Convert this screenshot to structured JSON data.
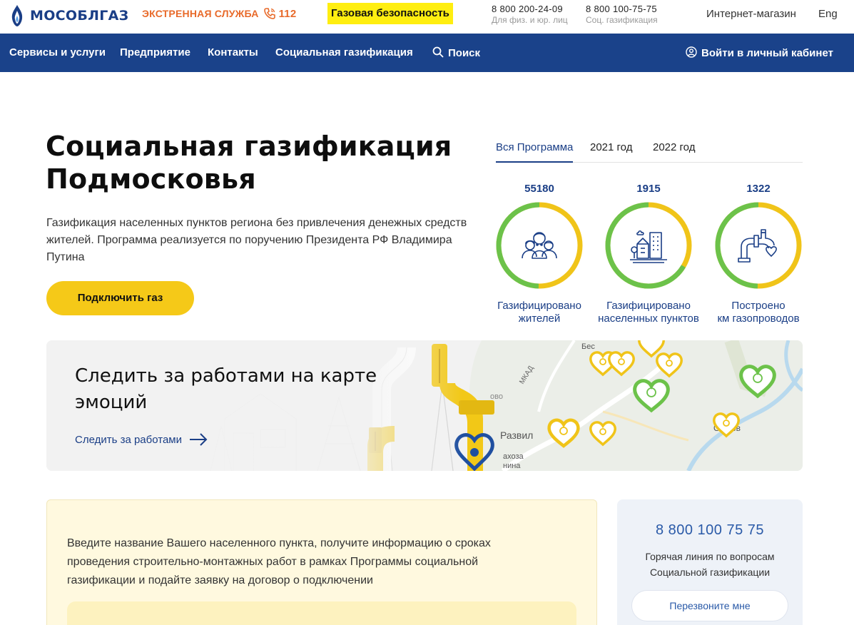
{
  "header": {
    "logo_text": "МОСОБЛГАЗ",
    "emergency_label": "ЭКСТРЕННАЯ СЛУЖБА",
    "emergency_number": "112",
    "gas_safety": "Газовая безопасность",
    "phones": [
      {
        "number": "8 800 200-24-09",
        "caption": "Для физ. и юр. лиц"
      },
      {
        "number": "8 800 100-75-75",
        "caption": "Соц. газификация"
      }
    ],
    "shop_link": "Интернет-магазин",
    "lang_link": "Eng"
  },
  "nav": {
    "items": [
      "Сервисы и услуги",
      "Предприятие",
      "Контакты",
      "Социальная газификация"
    ],
    "search_label": "Поиск",
    "account_label": "Войти в личный кабинет"
  },
  "hero": {
    "title_line1": "Социальная газификация",
    "title_line2": "Подмосковья",
    "description": "Газификация населенных пунктов региона без привлечения денежных средств жителей. Программа реализуется по поручению Президента РФ Владимира Путина",
    "connect_button": "Подключить газ"
  },
  "tabs": [
    "Вся Программа",
    "2021 год",
    "2022 год"
  ],
  "active_tab": 0,
  "stats": [
    {
      "value": "55180",
      "label_line1": "Газифицировано",
      "label_line2": "жителей",
      "icon": "people-icon"
    },
    {
      "value": "1915",
      "label_line1": "Газифицировано",
      "label_line2": "населенных пунктов",
      "icon": "buildings-icon"
    },
    {
      "value": "1322",
      "label_line1": "Построено",
      "label_line2": "км газопроводов",
      "icon": "pipe-heart-icon"
    }
  ],
  "colors": {
    "brand_blue": "#1a428a",
    "accent_yellow": "#f5c918",
    "highlight_yellow": "#ffee10",
    "emergency_orange": "#e86a2a",
    "ring_green": "#6cc24a",
    "ring_yellow": "#f0c419"
  },
  "map_banner": {
    "title_line1": "Следить за работами на карте",
    "title_line2": "эмоций",
    "link": "Следить за работами",
    "map_labels": [
      "Бес",
      "Развил",
      "Ос",
      "ов",
      "МКАД",
      "ахоза",
      "нина",
      "ово"
    ]
  },
  "search_panel": {
    "text": "Введите название Вашего населенного пункта, получите информацию о сроках проведения строительно-монтажных работ в рамках Программы социальной газификации и подайте заявку на договор о подключении"
  },
  "hotline": {
    "number": "8 800 100 75 75",
    "desc_line1": "Горячая линия по вопросам",
    "desc_line2": "Социальной газификации",
    "callback_button": "Перезвоните мне"
  }
}
